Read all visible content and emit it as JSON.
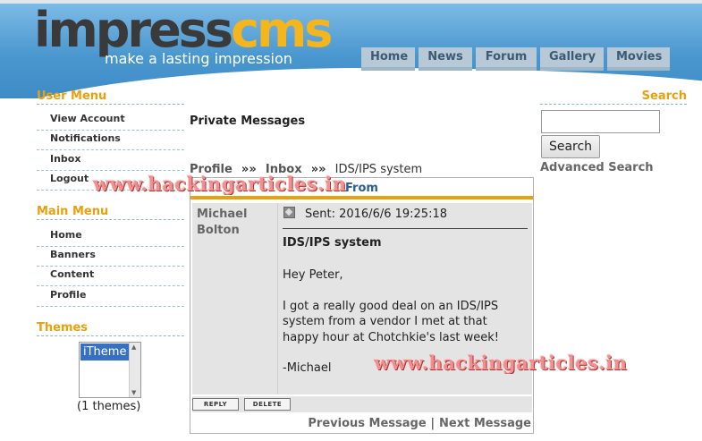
{
  "header": {
    "logo_part1": "impress",
    "logo_part2": "cms",
    "tagline": "make a lasting impression",
    "nav": [
      "Home",
      "News",
      "Forum",
      "Gallery",
      "Movies"
    ]
  },
  "sidebar": {
    "user_menu_title": "User Menu",
    "user_menu": [
      "View Account",
      "Notifications",
      "Inbox",
      "Logout"
    ],
    "main_menu_title": "Main Menu",
    "main_menu": [
      "Home",
      "Banners",
      "Content",
      "Profile"
    ],
    "themes_title": "Themes",
    "themes_selected": "iTheme",
    "themes_count": "(1 themes)"
  },
  "main": {
    "page_title": "Private Messages",
    "breadcrumb": [
      "Profile",
      "Inbox",
      "IDS/IPS system"
    ],
    "breadcrumb_sep": "»»",
    "from_header": "From",
    "sender": "Michael Bolton",
    "sent": "Sent: 2016/6/6 19:25:18",
    "subject": "IDS/IPS system",
    "body": [
      "Hey Peter,",
      "I got a really good deal on an IDS/IPS system from a vendor I met at that happy hour at Chotchkie's last week!",
      "-Michael"
    ],
    "reply_label": "REPLY",
    "delete_label": "DELETE",
    "prev_label": "Previous Message",
    "pager_sep": "|",
    "next_label": "Next Message"
  },
  "search": {
    "title": "Search",
    "input_value": "",
    "button_label": "Search",
    "advanced_label": "Advanced Search"
  },
  "watermark": "www.hackingarticles.in",
  "colors": {
    "accent_orange": "#e8a10e",
    "header_blue": "#4a97cf",
    "theme_select": "#3670c2"
  }
}
